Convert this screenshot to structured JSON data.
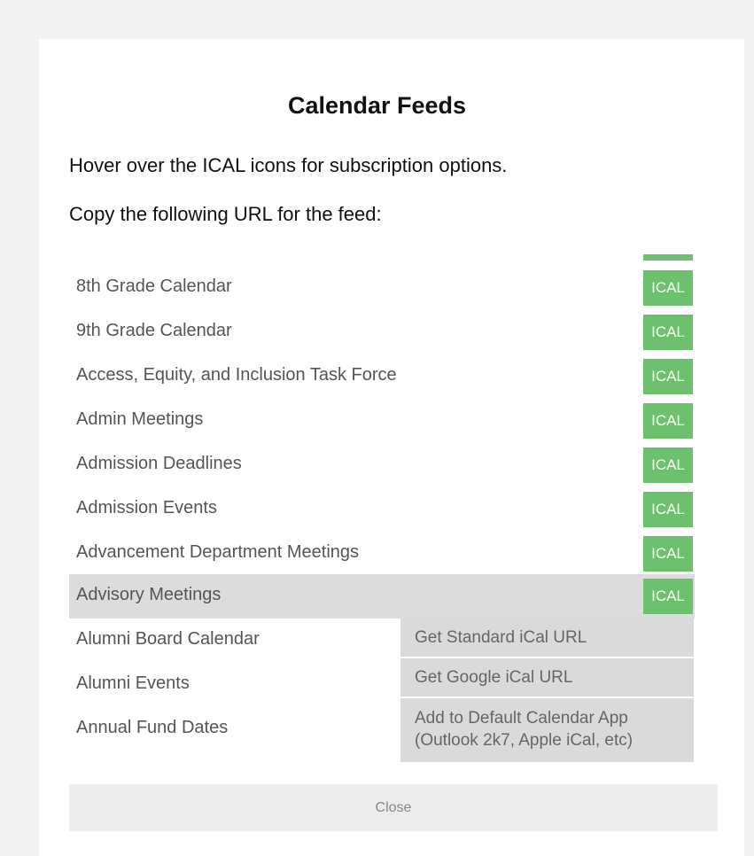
{
  "modal": {
    "title": "Calendar Feeds",
    "instruction_hover": "Hover over the ICAL icons for subscription options.",
    "instruction_copy": "Copy the following URL for the feed:",
    "close_label": "Close"
  },
  "feeds": [
    {
      "label": "8th Grade Calendar",
      "ical": "ICAL"
    },
    {
      "label": "9th Grade Calendar",
      "ical": "ICAL"
    },
    {
      "label": "Access, Equity, and Inclusion Task Force",
      "ical": "ICAL"
    },
    {
      "label": "Admin Meetings",
      "ical": "ICAL"
    },
    {
      "label": "Admission Deadlines",
      "ical": "ICAL"
    },
    {
      "label": "Admission Events",
      "ical": "ICAL"
    },
    {
      "label": "Advancement Department Meetings",
      "ical": "ICAL"
    },
    {
      "label": "Advisory Meetings",
      "ical": "ICAL"
    },
    {
      "label": "Alumni Board Calendar"
    },
    {
      "label": "Alumni Events"
    },
    {
      "label": "Annual Fund Dates"
    }
  ],
  "dropdown": {
    "standard": "Get Standard iCal URL",
    "google": "Get Google iCal URL",
    "default_app_line1": "Add to Default Calendar App",
    "default_app_line2": "(Outlook 2k7, Apple iCal, etc)"
  },
  "colors": {
    "ical_green": "#6dc06d",
    "highlight_row": "#dcdcdc",
    "dropdown_bg": "#dadada",
    "page_bg": "#f2f2f2"
  }
}
